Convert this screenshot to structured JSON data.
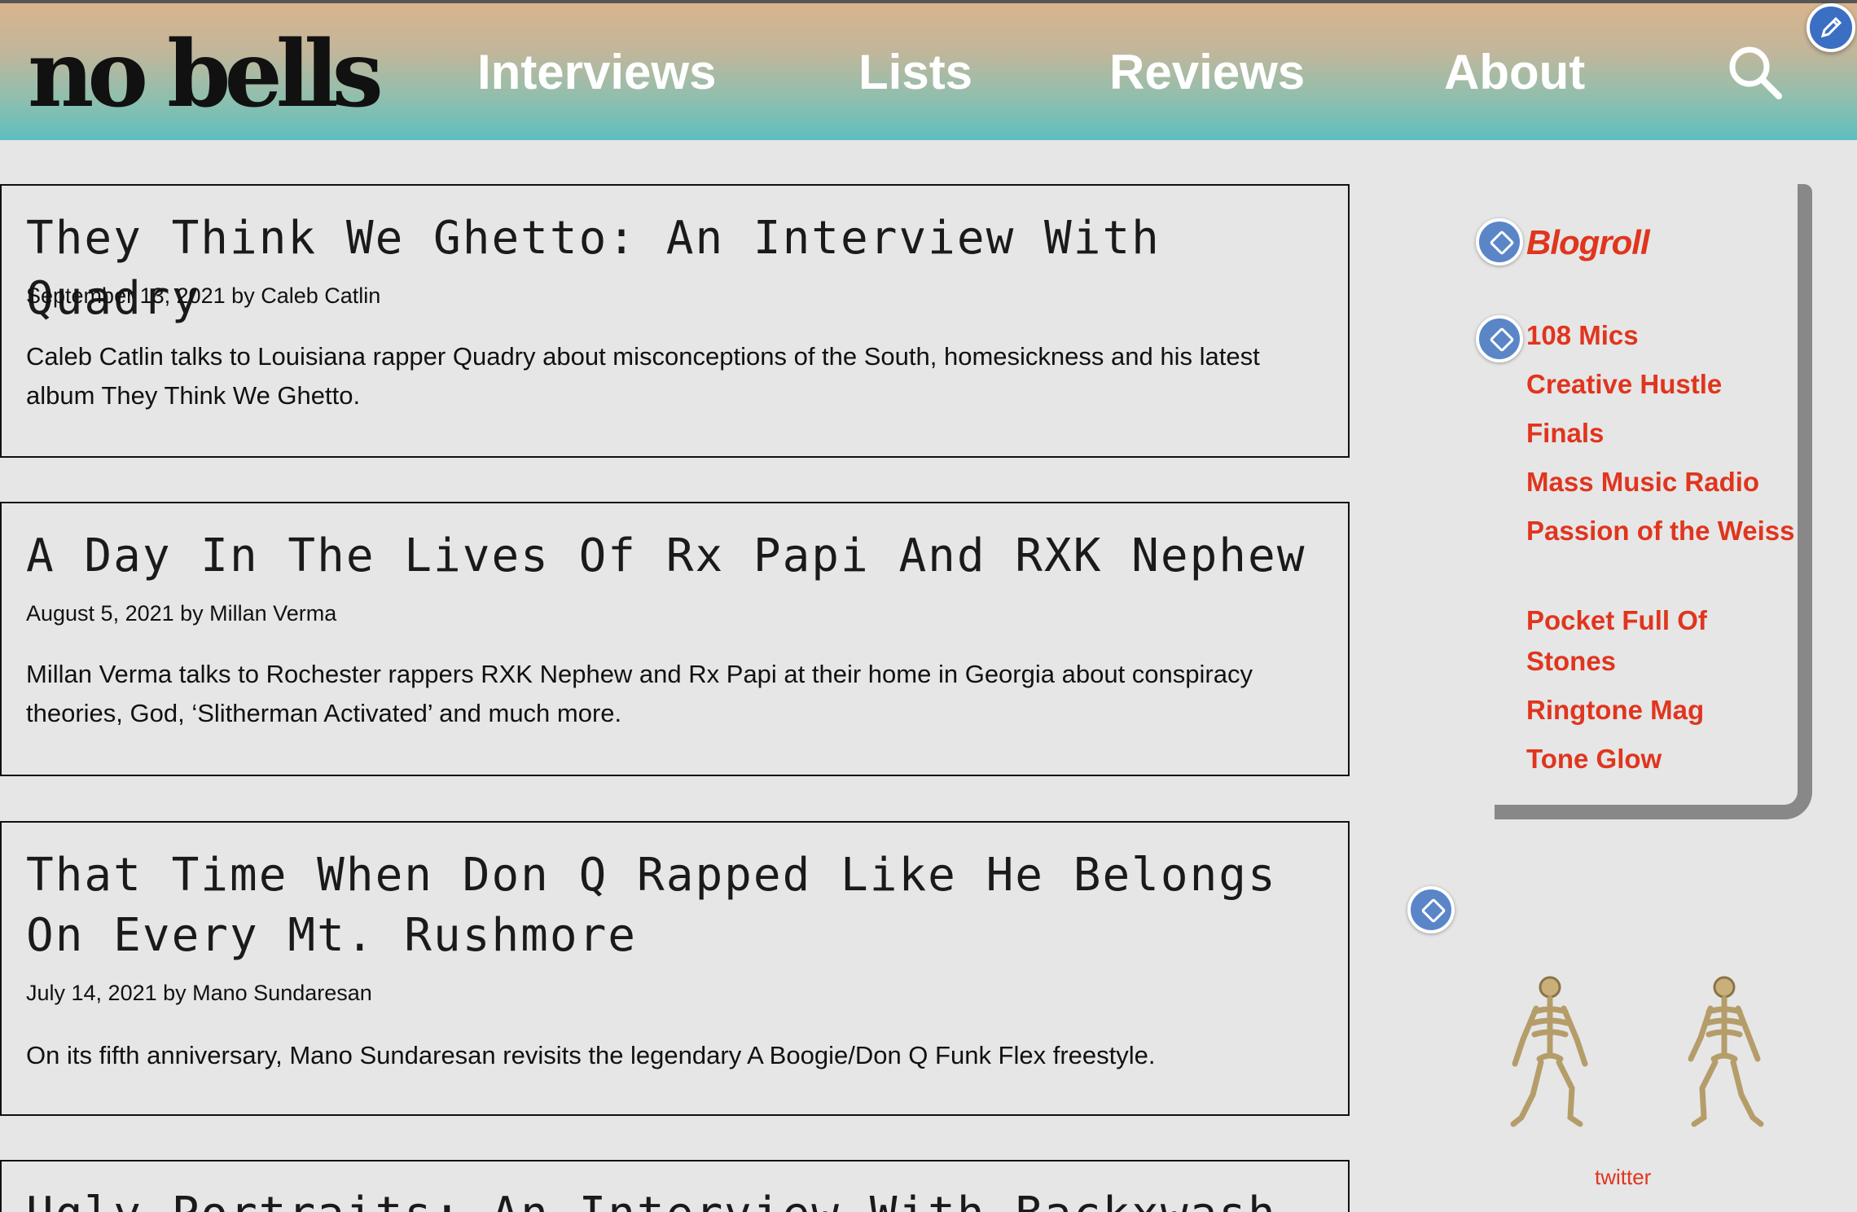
{
  "site": {
    "logo": "no bells"
  },
  "nav": [
    {
      "label": "Interviews"
    },
    {
      "label": "Lists"
    },
    {
      "label": "Reviews"
    },
    {
      "label": "About"
    }
  ],
  "articles": [
    {
      "title": "They Think We Ghetto: An Interview With Quadry",
      "meta": "September 13, 2021 by Caleb Catlin",
      "excerpt": "Caleb Catlin talks to Louisiana rapper Quadry about misconceptions of the South, homesickness and his latest album They Think We Ghetto."
    },
    {
      "title": "A Day In The Lives Of Rx Papi And RXK Nephew",
      "meta": "August 5, 2021 by Millan Verma",
      "excerpt": "Millan Verma talks to Rochester rappers RXK Nephew and Rx Papi at their home in Georgia about conspiracy theories, God, ‘Slitherman Activated’ and much more."
    },
    {
      "title": "That Time When Don Q Rapped Like He Belongs On Every Mt. Rushmore",
      "meta": "July 14, 2021 by Mano Sundaresan",
      "excerpt": "On its fifth anniversary, Mano Sundaresan revisits the legendary A Boogie/Don Q Funk Flex freestyle."
    },
    {
      "title": "Ugly Portraits: An Interview With Backxwash"
    }
  ],
  "blogroll": {
    "title": "Blogroll",
    "links": [
      "108 Mics",
      "Creative Hustle",
      "Finals",
      "Mass Music Radio",
      "Passion of the Weiss",
      "Pocket Full Of Stones",
      "Ringtone Mag",
      "Tone Glow"
    ]
  },
  "footer": {
    "twitter": "twitter"
  },
  "colors": {
    "accent": "#e0351e",
    "header_top": "#d9b48e",
    "header_bottom": "#5dbfbf",
    "background": "#e6e6e6"
  },
  "icons": [
    "search-icon",
    "pencil-icon",
    "skeleton-gif"
  ]
}
